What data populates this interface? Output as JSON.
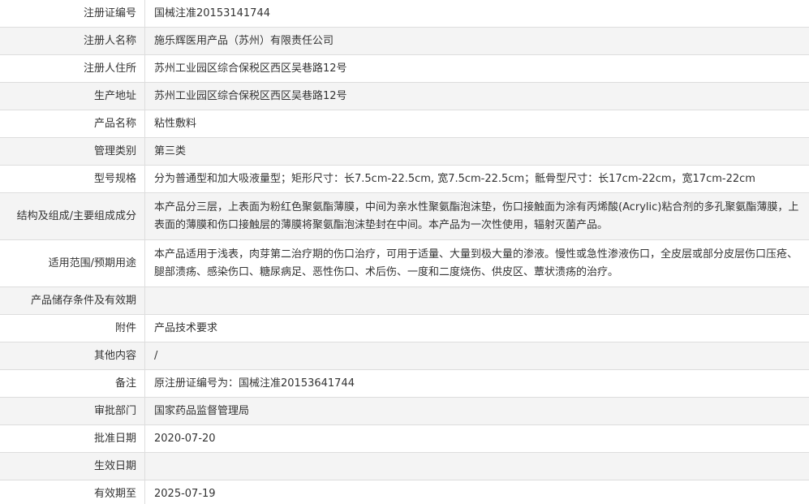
{
  "rows": [
    {
      "label": "注册证编号",
      "value": "国械注准20153141744"
    },
    {
      "label": "注册人名称",
      "value": "施乐辉医用产品（苏州）有限责任公司"
    },
    {
      "label": "注册人住所",
      "value": "苏州工业园区综合保税区西区吴巷路12号"
    },
    {
      "label": "生产地址",
      "value": "苏州工业园区综合保税区西区吴巷路12号"
    },
    {
      "label": "产品名称",
      "value": "粘性敷料"
    },
    {
      "label": "管理类别",
      "value": "第三类"
    },
    {
      "label": "型号规格",
      "value": "分为普通型和加大吸液量型；矩形尺寸：长7.5cm-22.5cm, 宽7.5cm-22.5cm；骶骨型尺寸：长17cm-22cm，宽17cm-22cm"
    },
    {
      "label": "结构及组成/主要组成成分",
      "value": "本产品分三层，上表面为粉红色聚氨酯薄膜，中间为亲水性聚氨酯泡沫垫，伤口接触面为涂有丙烯酸(Acrylic)粘合剂的多孔聚氨酯薄膜，上表面的薄膜和伤口接触层的薄膜将聚氨酯泡沫垫封在中间。本产品为一次性使用，辐射灭菌产品。"
    },
    {
      "label": "适用范围/预期用途",
      "value": "本产品适用于浅表，肉芽第二治疗期的伤口治疗，可用于适量、大量到极大量的渗液。慢性或急性渗液伤口，全皮层或部分皮层伤口压疮、腿部溃疡、感染伤口、糖尿病足、恶性伤口、术后伤、一度和二度烧伤、供皮区、蕈状溃疡的治疗。"
    },
    {
      "label": "产品储存条件及有效期",
      "value": ""
    },
    {
      "label": "附件",
      "value": "产品技术要求"
    },
    {
      "label": "其他内容",
      "value": "/"
    },
    {
      "label": "备注",
      "value": "原注册证编号为：国械注准20153641744"
    },
    {
      "label": "审批部门",
      "value": "国家药品监督管理局"
    },
    {
      "label": "批准日期",
      "value": "2020-07-20"
    },
    {
      "label": "生效日期",
      "value": ""
    },
    {
      "label": "有效期至",
      "value": "2025-07-19"
    }
  ]
}
